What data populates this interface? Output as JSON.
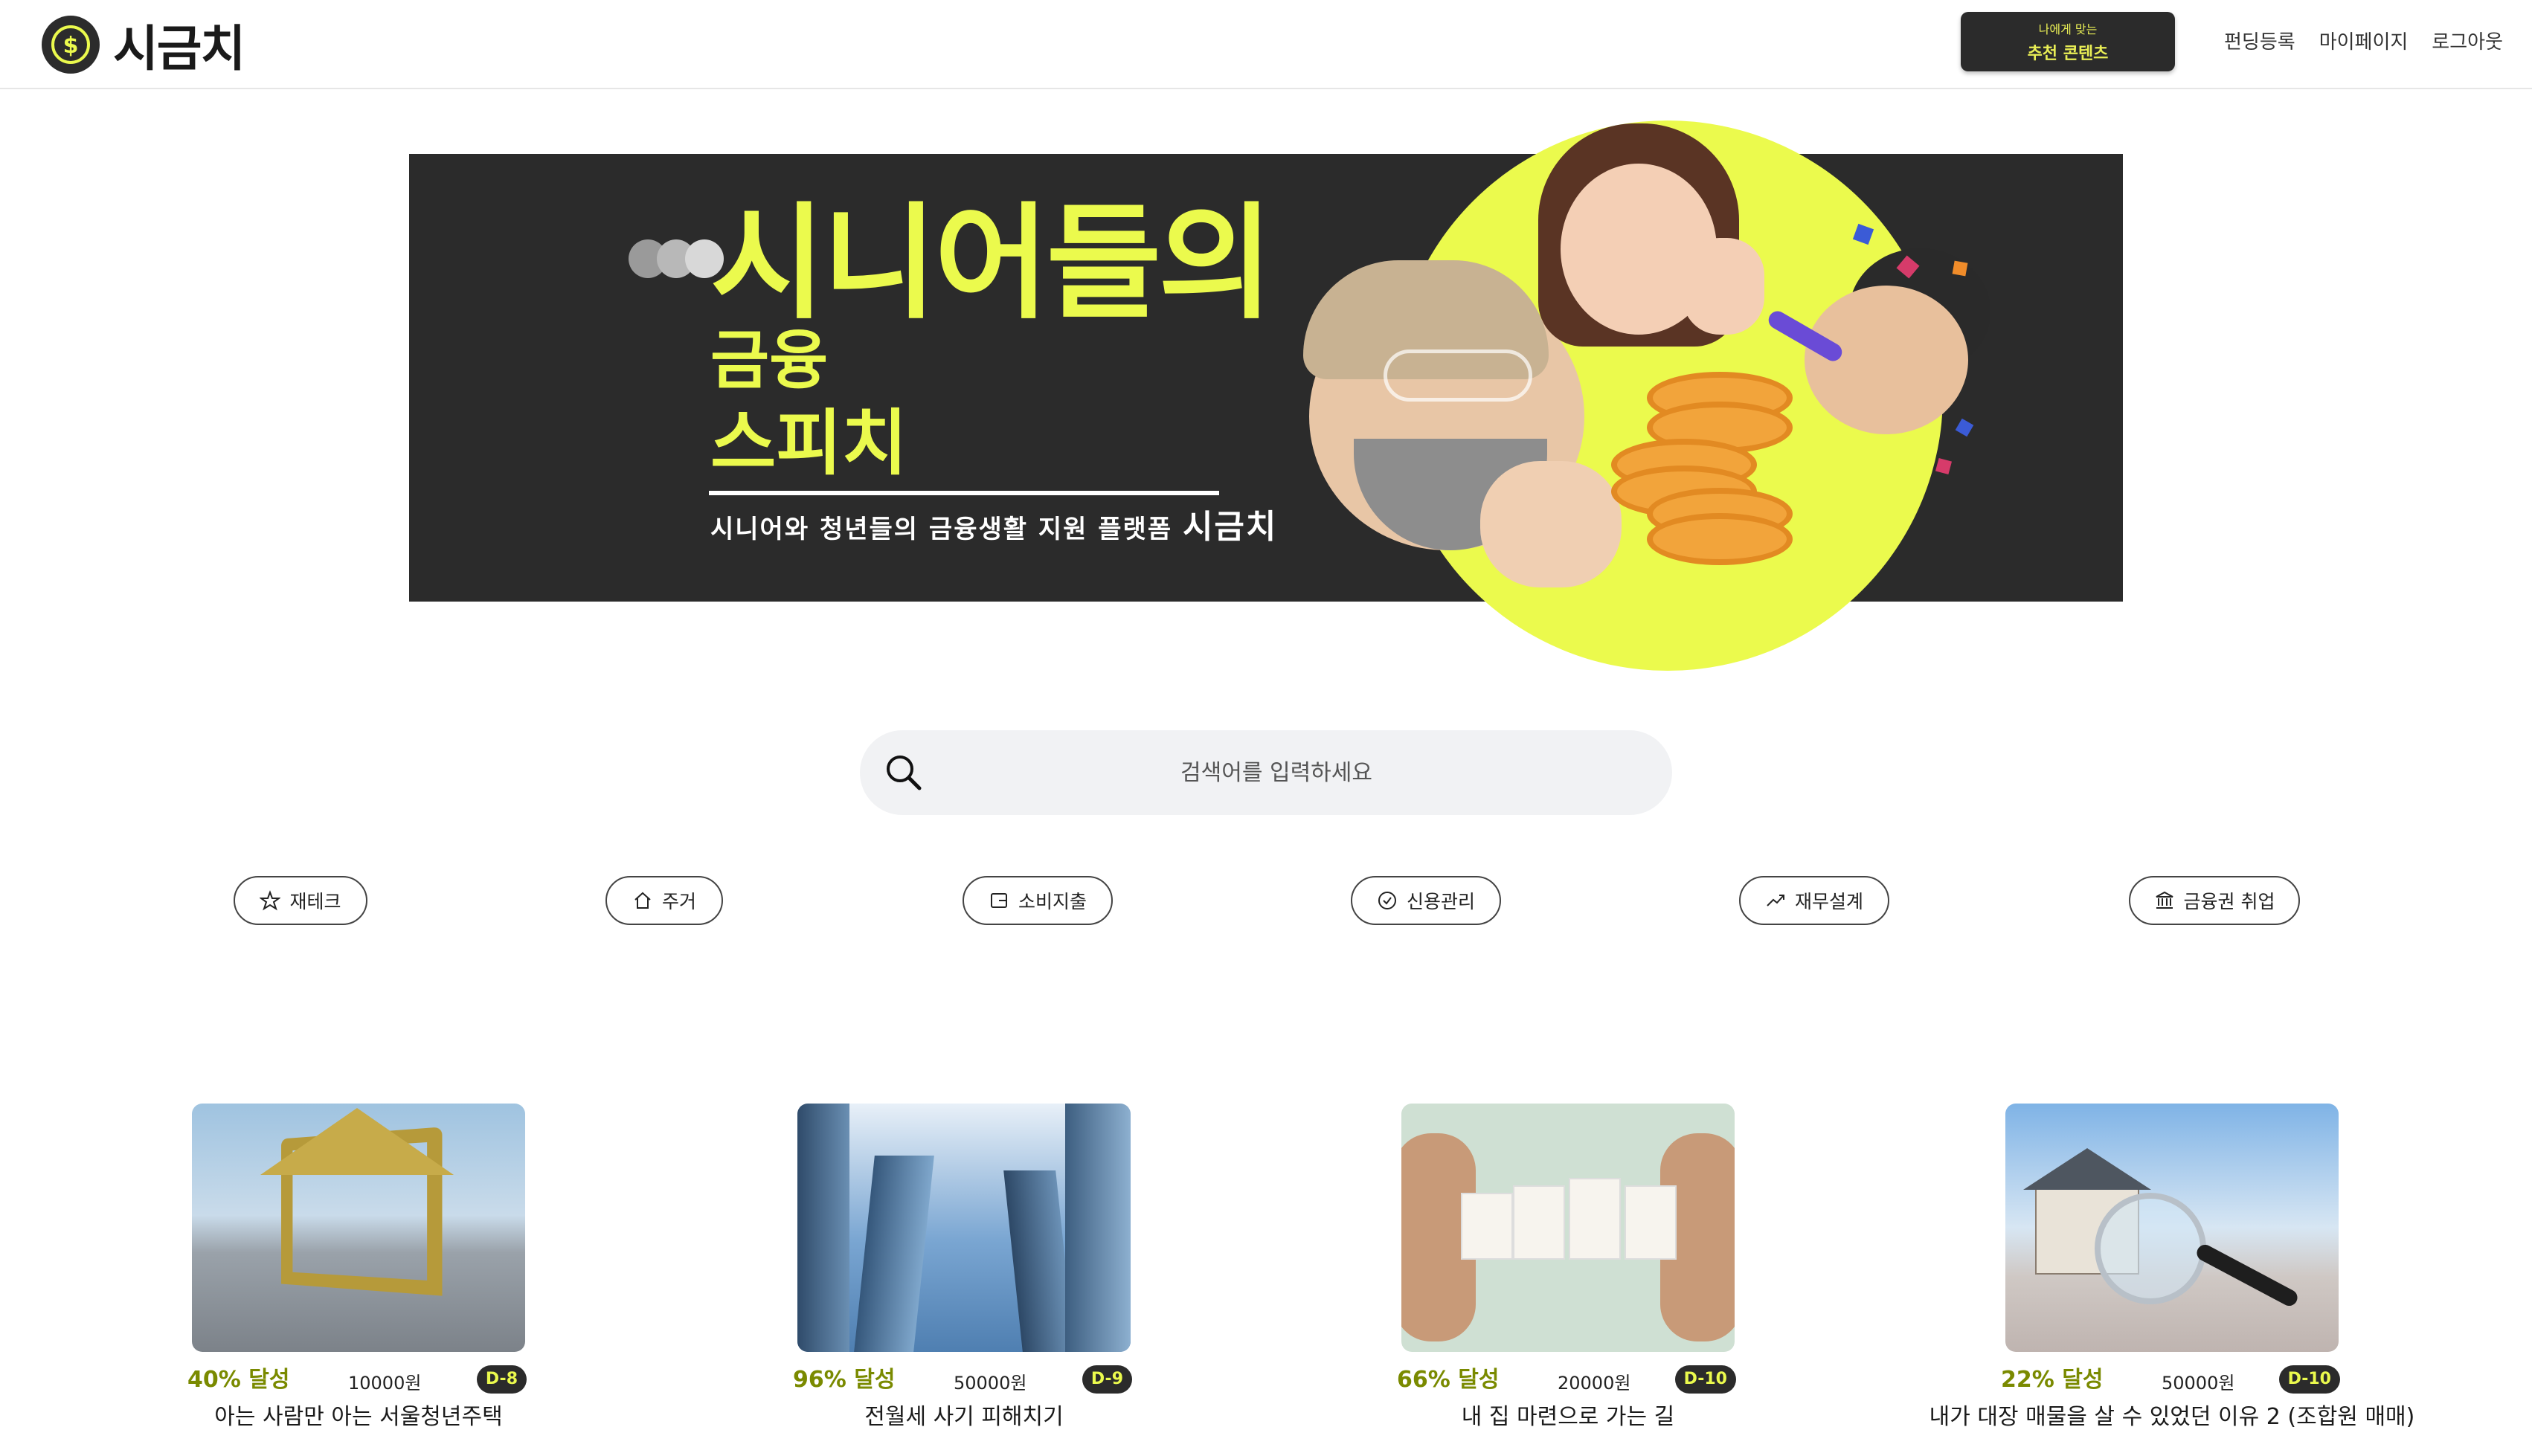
{
  "header": {
    "logo_text": "시금치",
    "recommend_small": "나에게 맞는",
    "recommend_main": "추천 콘텐츠",
    "nav": [
      "펀딩등록",
      "마이페이지",
      "로그아웃"
    ]
  },
  "banner": {
    "title": "시니어들의",
    "line2": "금융",
    "line3": "스피치",
    "subtitle": "시니어와 청년들의 금융생활 지원 플랫폼",
    "subtitle_brand": "시금치"
  },
  "search": {
    "placeholder": "검색어를 입력하세요"
  },
  "categories": [
    {
      "label": "재테크",
      "icon": "star-icon"
    },
    {
      "label": "주거",
      "icon": "home-icon"
    },
    {
      "label": "소비지출",
      "icon": "wallet-icon"
    },
    {
      "label": "신용관리",
      "icon": "check-circle-icon"
    },
    {
      "label": "재무설계",
      "icon": "trending-up-icon"
    },
    {
      "label": "금융권 취업",
      "icon": "bank-icon"
    }
  ],
  "cards": [
    {
      "progress": "40% 달성",
      "price": "10000원",
      "dday": "D-8",
      "title": "아는 사람만 아는 서울청년주택"
    },
    {
      "progress": "96% 달성",
      "price": "50000원",
      "dday": "D-9",
      "title": "전월세 사기 피해치기"
    },
    {
      "progress": "66% 달성",
      "price": "20000원",
      "dday": "D-10",
      "title": "내 집 마련으로 가는 길"
    },
    {
      "progress": "22% 달성",
      "price": "50000원",
      "dday": "D-10",
      "title": "내가 대장 매물을 살 수 있었던 이유 2 (조합원 매매)"
    }
  ],
  "colors": {
    "accent": "#ebfa4d",
    "dark": "#2b2b2b",
    "progress_text": "#7a8a00"
  }
}
